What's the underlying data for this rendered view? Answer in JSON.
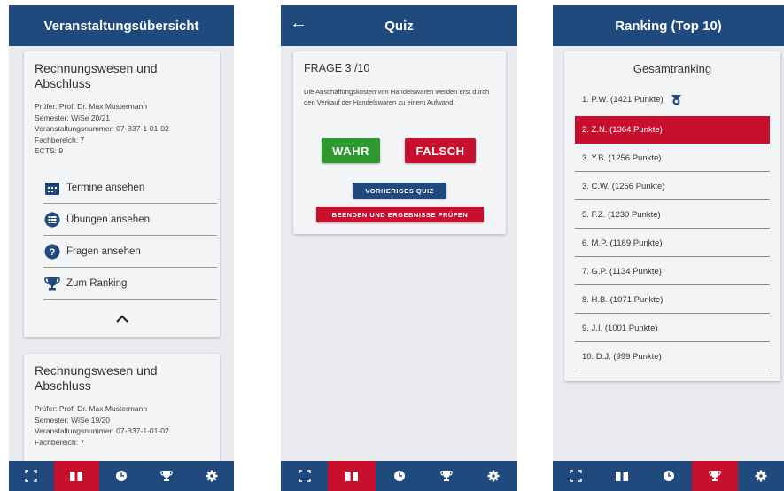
{
  "screen1": {
    "title": "Veranstaltungsübersicht",
    "courses": [
      {
        "name": "Rechnungswesen und Abschluss",
        "examiner": "Prüfer: Prof. Dr. Max Mustermann",
        "semester": "Semester: WiSe 20/21",
        "course_number": "Veranstaltungsnummer: 07-B37-1-01-02",
        "department": "Fachbereich: 7",
        "ects": "ECTS: 9"
      },
      {
        "name": "Rechnungswesen und Abschluss",
        "examiner": "Prüfer: Prof. Dr. Max Mustermann",
        "semester": "Semester: WiSe 19/20",
        "course_number": "Veranstaltungsnummer: 07-B37-1-01-02",
        "department": "Fachbereich: 7"
      }
    ],
    "menu": [
      {
        "label": "Termine ansehen",
        "icon": "calendar-icon"
      },
      {
        "label": "Übungen ansehen",
        "icon": "list-icon"
      },
      {
        "label": "Fragen ansehen",
        "icon": "help-icon"
      },
      {
        "label": "Zum Ranking",
        "icon": "trophy-icon"
      }
    ]
  },
  "screen2": {
    "title": "Quiz",
    "question_header": "FRAGE 3 /10",
    "question_text": "Die Anschaffungskosten von Handelswaren werden erst durch den Verkauf der Handelswaren zu einem Aufwand.",
    "true_label": "WAHR",
    "false_label": "FALSCH",
    "prev_label": "VORHERIGES QUIZ",
    "finish_label": "BEENDEN UND ERGEBNISSE PRÜFEN"
  },
  "screen3": {
    "title": "Ranking (Top 10)",
    "heading": "Gesamtranking",
    "entries": [
      "1. P.W. (1421 Punkte)",
      "2. Z.N. (1364 Punkte)",
      "3. Y.B. (1256 Punkte)",
      "3. C.W. (1256 Punkte)",
      "5. F.Z. (1230 Punkte)",
      "6. M.P. (1189 Punkte)",
      "7. G.P. (1134 Punkte)",
      "8. H.B. (1071 Punkte)",
      "9. J.I. (1001 Punkte)",
      "10. D.J. (999 Punkte)"
    ],
    "highlighted_entry": "2. Z.N. (1364 Punkte)"
  },
  "bottom_nav": [
    "scan-icon",
    "book-icon",
    "clock-icon",
    "trophy-icon",
    "gear-icon"
  ],
  "colors": {
    "primary": "#204a7e",
    "accent": "#c8102e",
    "true": "#2e9a2e",
    "background": "#e9ebef"
  }
}
